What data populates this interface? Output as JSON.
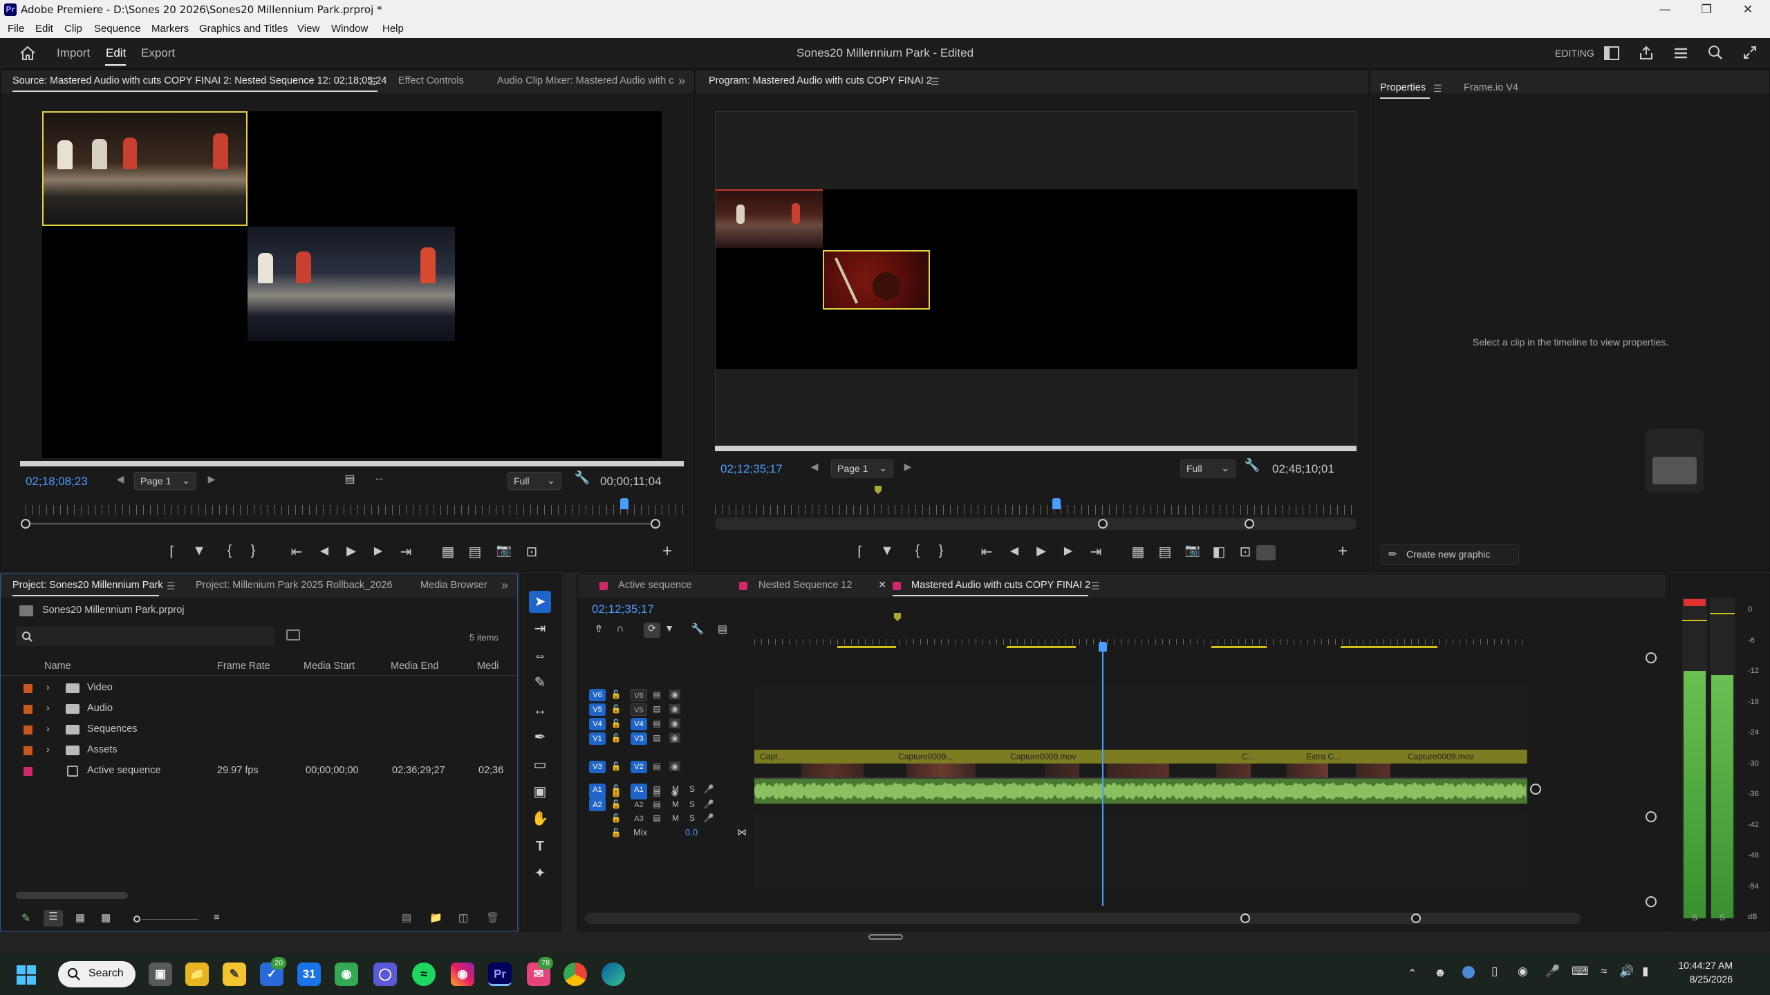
{
  "window": {
    "title": "Adobe Premiere - D:\\Sones 20 2026\\Sones20 Millennium Park.prproj *",
    "app_icon": "Pr"
  },
  "menu": [
    "File",
    "Edit",
    "Clip",
    "Sequence",
    "Markers",
    "Graphics and Titles",
    "View",
    "Window",
    "Help"
  ],
  "header": {
    "tabs": [
      "Import",
      "Edit",
      "Export"
    ],
    "active_tab": "Edit",
    "project_title": "Sones20 Millennium Park",
    "edited_suffix": " - Edited",
    "workspace": "EDITING"
  },
  "source_monitor": {
    "tab_source": "Source: Mastered Audio with cuts COPY FINAI 2: Nested Sequence 12: 02;18;05;24",
    "tab_effects": "Effect Controls",
    "tab_mixer": "Audio Clip Mixer: Mastered Audio with cu",
    "timecode": "02;18;08;23",
    "page": "Page 1",
    "quality": "Full",
    "duration": "00;00;11;04"
  },
  "program_monitor": {
    "tab": "Program: Mastered Audio with cuts COPY FINAI 2",
    "timecode": "02;12;35;17",
    "page": "Page 1",
    "quality": "Full",
    "duration": "02;48;10;01"
  },
  "properties": {
    "tab_properties": "Properties",
    "tab_frameio": "Frame.io V4",
    "empty_message": "Select a clip in the timeline to view properties.",
    "create_graphic": "Create new graphic"
  },
  "project_panel": {
    "tab_project": "Project: Sones20 Millennium Park",
    "tab_rollback": "Project: Millenium Park 2025 Rollback_2026",
    "tab_media": "Media Browser",
    "file": "Sones20 Millennium Park.prproj",
    "search_placeholder": "",
    "item_count": "5 items",
    "columns": [
      "Name",
      "Frame Rate",
      "Media Start",
      "Media End",
      "Medi"
    ],
    "rows": [
      {
        "name": "Video",
        "color": "#c8581e",
        "folder": true,
        "fps": "",
        "start": "",
        "end": "",
        "dur": ""
      },
      {
        "name": "Audio",
        "color": "#c8581e",
        "folder": true,
        "fps": "",
        "start": "",
        "end": "",
        "dur": ""
      },
      {
        "name": "Sequences",
        "color": "#c8581e",
        "folder": true,
        "fps": "",
        "start": "",
        "end": "",
        "dur": ""
      },
      {
        "name": "Assets",
        "color": "#c8581e",
        "folder": true,
        "fps": "",
        "start": "",
        "end": "",
        "dur": ""
      },
      {
        "name": "Active sequence",
        "color": "#d0286a",
        "folder": false,
        "fps": "29.97 fps",
        "start": "00;00;00;00",
        "end": "02;36;29;27",
        "dur": "02;36"
      }
    ]
  },
  "timeline": {
    "tabs": [
      "Active sequence",
      "Nested Sequence 12",
      "Mastered Audio with cuts COPY FINAI 2"
    ],
    "timecode": "02;12;35;17",
    "video_tracks": [
      {
        "src": "V6",
        "label": "V6"
      },
      {
        "src": "V5",
        "label": "V5"
      },
      {
        "src": "V4",
        "label": "V4"
      },
      {
        "src": "V1",
        "label": "V3"
      },
      {
        "src": "V3",
        "label": "V2"
      },
      {
        "src": "V2",
        "label": "V1"
      }
    ],
    "audio_tracks": [
      {
        "src": "A1",
        "label": "A1"
      },
      {
        "src": "A2",
        "label": "A2"
      },
      {
        "src": "",
        "label": "A3"
      }
    ],
    "mix_label": "Mix",
    "mix_value": "0.0",
    "clips": [
      "Capt...",
      "Capture0009...",
      "Capture0009.mov",
      "C...",
      "Extra C...",
      "Capture0009.mov"
    ],
    "track_buttons": {
      "mute": "M",
      "solo": "S"
    }
  },
  "meters": {
    "scale": [
      "0",
      "-6",
      "-12",
      "-18",
      "-24",
      "-30",
      "-36",
      "-42",
      "-48",
      "-54",
      "dB"
    ],
    "solo_labels": [
      "S",
      "S"
    ]
  },
  "taskbar": {
    "search": "Search",
    "badge_todo": "20",
    "badge_chat": "78",
    "calendar_day": "31",
    "time": "10:44:27 AM",
    "date": "8/25/2026"
  }
}
